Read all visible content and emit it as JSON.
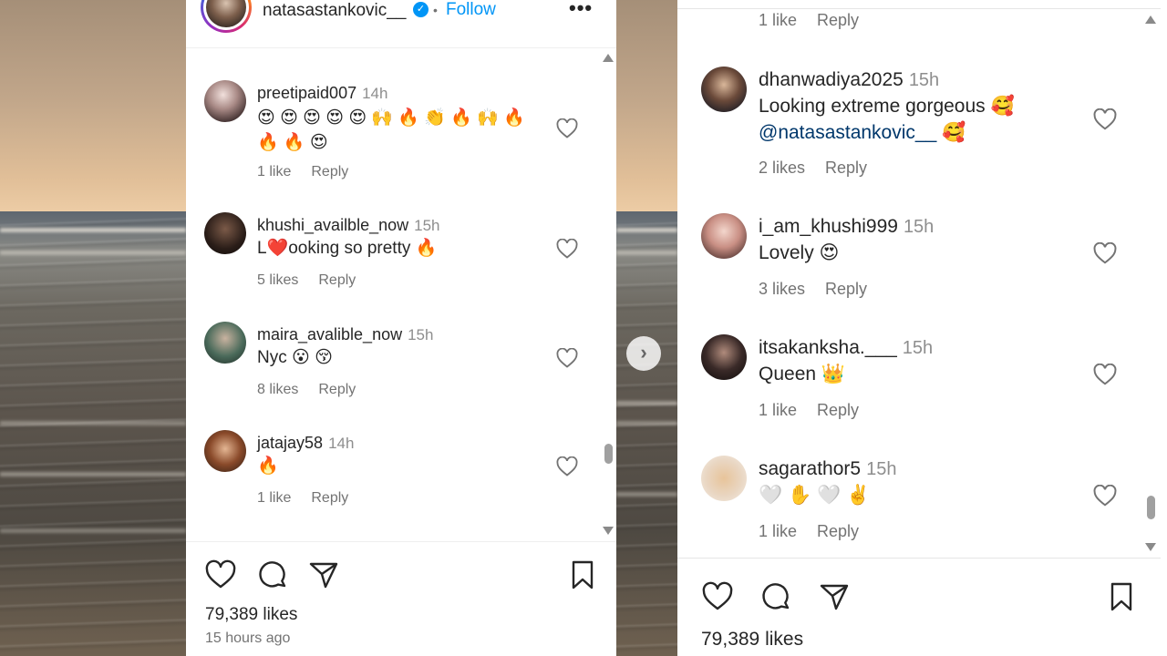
{
  "left_panel": {
    "header": {
      "username": "natasastankovic__",
      "separator": "•",
      "follow_label": "Follow",
      "more_label": "•••",
      "verified_mark": "✓"
    },
    "comments": [
      {
        "user": "preetipaid007",
        "time": "14h",
        "text_line1": "😍 😍 😍 😍 😍 🙌 🔥 👏 🔥 🙌 🔥",
        "text_line2": "🔥 🔥 😍",
        "meta": "1 like",
        "reply": "Reply"
      },
      {
        "user": "khushi_availble_now",
        "time": "15h",
        "text_line1": "L❤️ooking so pretty 🔥",
        "text_line2": "",
        "meta": "5 likes",
        "reply": "Reply"
      },
      {
        "user": "maira_avalible_now",
        "time": "15h",
        "text_line1": "Nyc 😮 😚",
        "text_line2": "",
        "meta": "8 likes",
        "reply": "Reply"
      },
      {
        "user": "jatajay58",
        "time": "14h",
        "text_line1": "🔥",
        "text_line2": "",
        "meta": "1 like",
        "reply": "Reply"
      }
    ],
    "likes_total": "79,389 likes",
    "time_ago": "15 hours ago"
  },
  "next_arrow": "›",
  "right_panel": {
    "top_meta": "1 like",
    "top_reply": "Reply",
    "comments": [
      {
        "user": "dhanwadiya2025",
        "time": "15h",
        "text_line1": "Looking extreme gorgeous 🥰",
        "mention": "@natasastankovic__",
        "mention_emoji": "🥰",
        "meta": "2 likes",
        "reply": "Reply"
      },
      {
        "user": "i_am_khushi999",
        "time": "15h",
        "text_line1": "Lovely 😍",
        "meta": "3 likes",
        "reply": "Reply"
      },
      {
        "user": "itsakanksha.___",
        "time": "15h",
        "text_line1": "Queen 👑",
        "meta": "1 like",
        "reply": "Reply"
      },
      {
        "user": "sagarathor5",
        "time": "15h",
        "text_line1": "🤍 ✋ 🤍 ✌️",
        "meta": "1 like",
        "reply": "Reply"
      }
    ],
    "likes_total": "79,389 likes"
  }
}
